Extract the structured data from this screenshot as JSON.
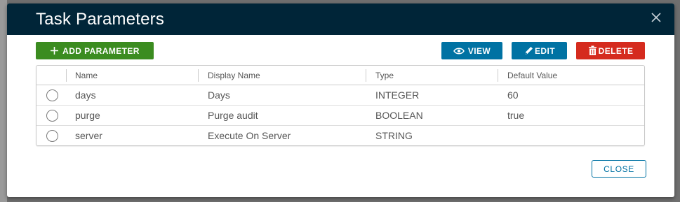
{
  "dialog": {
    "title": "Task Parameters",
    "close_icon": "close-icon"
  },
  "toolbar": {
    "add_label": "ADD PARAMETER",
    "view_label": "VIEW",
    "edit_label": "EDIT",
    "delete_label": "DELETE"
  },
  "table": {
    "columns": [
      "Name",
      "Display Name",
      "Type",
      "Default Value"
    ],
    "rows": [
      {
        "name": "days",
        "display_name": "Days",
        "type": "INTEGER",
        "default_value": "60"
      },
      {
        "name": "purge",
        "display_name": "Purge audit",
        "type": "BOOLEAN",
        "default_value": "true"
      },
      {
        "name": "server",
        "display_name": "Execute On Server",
        "type": "STRING",
        "default_value": ""
      }
    ]
  },
  "footer": {
    "close_label": "CLOSE"
  },
  "colors": {
    "header_bg": "#002538",
    "add_button": "#3b8c20",
    "primary_button": "#0072a3",
    "danger_button": "#d52b1e"
  }
}
